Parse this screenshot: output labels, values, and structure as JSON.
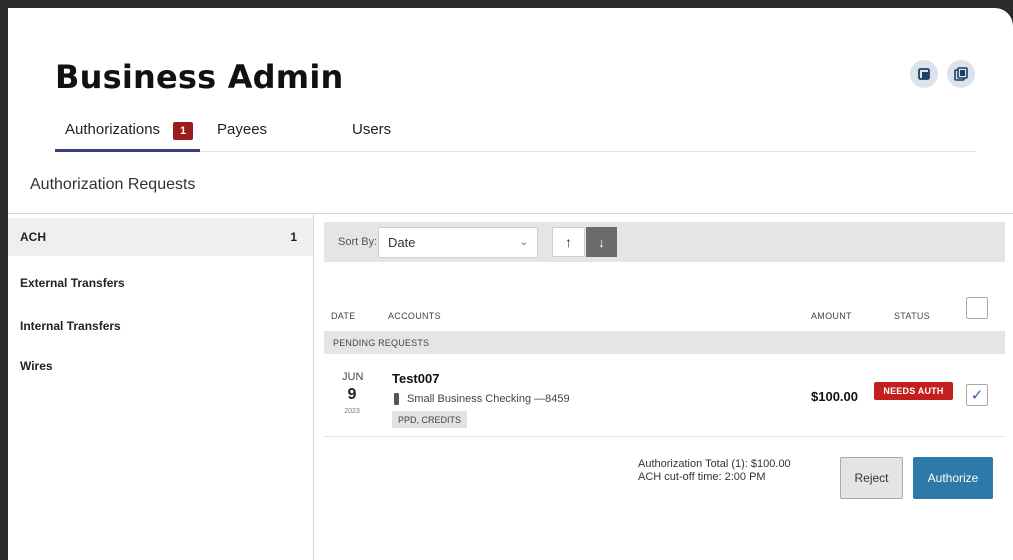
{
  "header": {
    "title": "Business Admin",
    "icons": [
      "export-icon",
      "copy-icon"
    ]
  },
  "tabs": [
    {
      "label": "Authorizations",
      "badge": "1",
      "active": true
    },
    {
      "label": "Payees"
    },
    {
      "label": "Users"
    }
  ],
  "section_title": "Authorization Requests",
  "sidebar": {
    "items": [
      {
        "label": "ACH",
        "count": "1",
        "active": true
      },
      {
        "label": "External Transfers"
      },
      {
        "label": "Internal Transfers"
      },
      {
        "label": "Wires"
      }
    ]
  },
  "sort": {
    "label": "Sort By:",
    "value": "Date",
    "up": "↑",
    "down": "↓"
  },
  "columns": {
    "date": "DATE",
    "accounts": "ACCOUNTS",
    "amount": "AMOUNT",
    "status": "STATUS"
  },
  "group_label": "PENDING REQUESTS",
  "request": {
    "month": "JUN",
    "day": "9",
    "year": "2023",
    "name": "Test007",
    "account": "Small Business Checking —8459",
    "tag": "PPD, CREDITS",
    "amount": "$100.00",
    "status": "NEEDS AUTH",
    "checked": true
  },
  "footer": {
    "total": "Authorization Total (1): $100.00",
    "cutoff": "ACH cut-off time: 2:00 PM",
    "reject_label": "Reject",
    "authorize_label": "Authorize"
  },
  "colors": {
    "accent": "#2d79a8",
    "badge": "#9e1b1b",
    "status": "#c41f1f",
    "tab_underline": "#3a3f7a"
  }
}
